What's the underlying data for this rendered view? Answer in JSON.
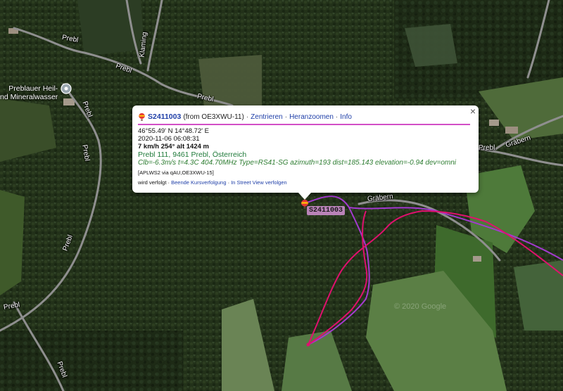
{
  "colors": {
    "track_primary": "#e0106e",
    "track_secondary": "#a43ad0",
    "accent_link": "#1f3fa8",
    "divider": "#d24fc6",
    "address_green": "#1f7a3a"
  },
  "map": {
    "road_labels": [
      "Prebl",
      "Prebl",
      "Prebl",
      "Prebl",
      "Prebl",
      "Prebl",
      "Prebl",
      "Gräbern",
      "Gräbern",
      "Klaming"
    ],
    "poi": {
      "line1": "Preblauer Heil-",
      "line2": "nd Mineralwasser",
      "icon": "map-pin-icon"
    },
    "copyright": "© 2020 Google"
  },
  "marker": {
    "label": "S2411003",
    "icon": "balloon-icon"
  },
  "info": {
    "callsign": "S2411003",
    "from": "(from OE3XWU-11)",
    "sep": "·",
    "links": {
      "center": "Zentrieren",
      "zoom": "Heranzoomen",
      "info": "Info"
    },
    "position": "46°55.49' N 14°48.72' E",
    "timestamp": "2020-11-06 06:08:31",
    "motion": "7 km/h 254° alt 1424 m",
    "address": "Prebl 111, 9461 Prebl, Österreich",
    "comment": "Clb=-6.3m/s t=4.3C 404.70MHz Type=RS41-SG azimuth=193 dist=185.143 elevation=-0.94 dev=omni",
    "path": "[APLWS2 via qAU,OE3XWU-15]",
    "followed": "wird verfolgt ·",
    "stop_follow": "Beende Kursverfolgung",
    "streetview": "In Street View verfolgen",
    "close": "×"
  }
}
